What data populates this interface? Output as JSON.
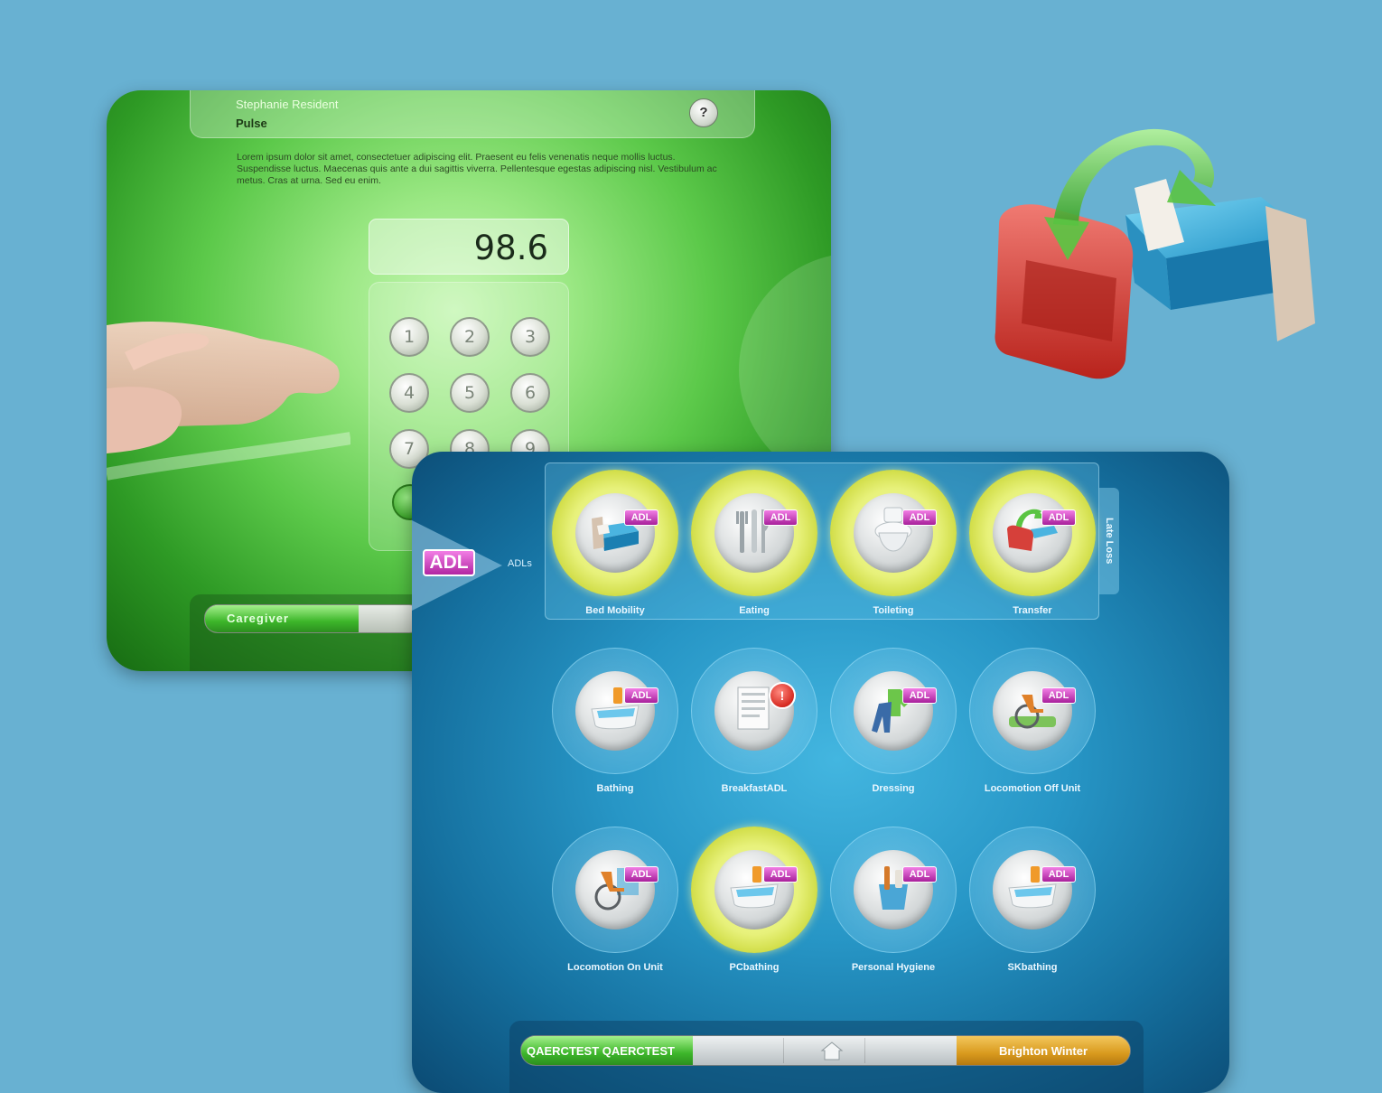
{
  "pulse_screen": {
    "resident_name": "Stephanie Resident",
    "title": "Pulse",
    "help_label": "?",
    "description": "Lorem ipsum dolor sit amet, consectetuer adipiscing elit. Praesent eu felis venenatis neque mollis luctus. Suspendisse luctus. Maecenas quis ante a dui sagittis viverra. Pellentesque egestas adipiscing nisl. Vestibulum ac metus. Cras at urna. Sed eu enim.",
    "value": "98.6",
    "keys": [
      "1",
      "2",
      "3",
      "4",
      "5",
      "6",
      "7",
      "8",
      "9"
    ],
    "caregiver_label": "Caregiver"
  },
  "adl_screen": {
    "category_logo": "ADL",
    "category_label": "ADLs",
    "section_label": "Late Loss",
    "badge_text": "ADL",
    "tiles": [
      {
        "label": "Bed Mobility",
        "icon": "bed-icon",
        "active": true,
        "badge": "adl"
      },
      {
        "label": "Eating",
        "icon": "utensils-icon",
        "active": true,
        "badge": "adl"
      },
      {
        "label": "Toileting",
        "icon": "toilet-icon",
        "active": true,
        "badge": "adl"
      },
      {
        "label": "Transfer",
        "icon": "transfer-icon",
        "active": true,
        "badge": "adl"
      },
      {
        "label": "Bathing",
        "icon": "bathtub-icon",
        "active": false,
        "badge": "adl"
      },
      {
        "label": "BreakfastADL",
        "icon": "form-icon",
        "active": false,
        "badge": "alert"
      },
      {
        "label": "Dressing",
        "icon": "clothes-icon",
        "active": false,
        "badge": "adl"
      },
      {
        "label": "Locomotion Off Unit",
        "icon": "wheelchair-outdoor-icon",
        "active": false,
        "badge": "adl"
      },
      {
        "label": "Locomotion On Unit",
        "icon": "wheelchair-icon",
        "active": false,
        "badge": "adl"
      },
      {
        "label": "PCbathing",
        "icon": "bathtub-icon",
        "active": true,
        "badge": "adl"
      },
      {
        "label": "Personal Hygiene",
        "icon": "hygiene-icon",
        "active": false,
        "badge": "adl"
      },
      {
        "label": "SKbathing",
        "icon": "bathtub-icon",
        "active": false,
        "badge": "adl"
      }
    ],
    "status_left": "QAERCTEST QAERCTEST",
    "status_right": "Brighton Winter"
  },
  "colors": {
    "background": "#68b1d2",
    "active_ring": "#e7f17a",
    "adl_badge": "#c63ab6",
    "status_green": "#3db62a",
    "status_orange": "#d99a1e"
  }
}
